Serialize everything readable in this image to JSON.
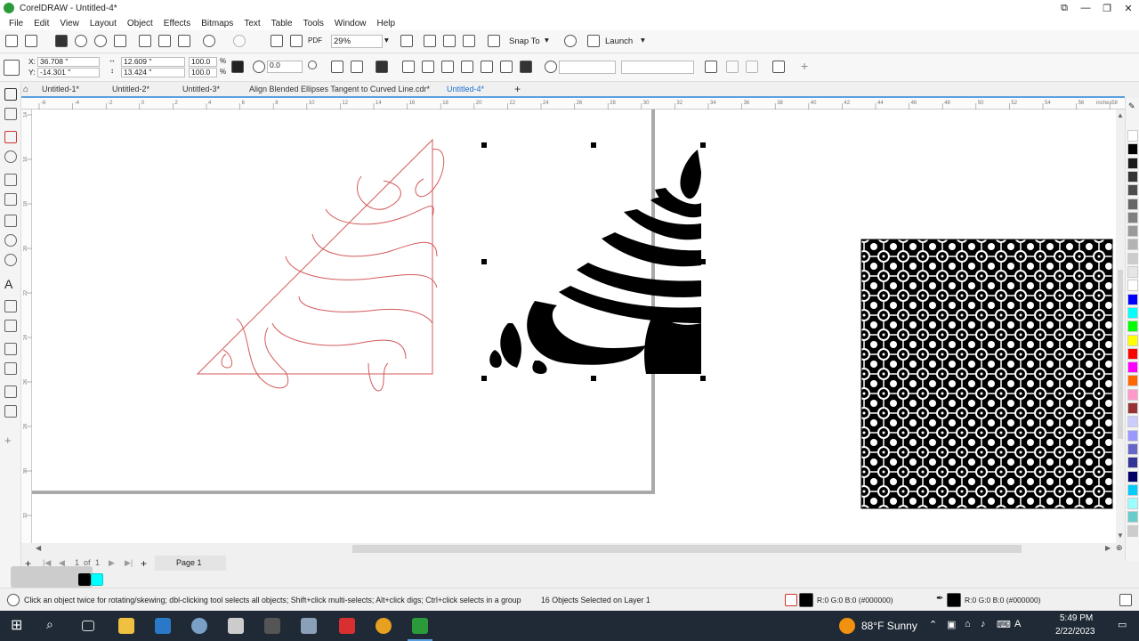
{
  "app": {
    "title": "CorelDRAW - Untitled-4*",
    "window_buttons": [
      "⧉",
      "—",
      "❐",
      "✕"
    ]
  },
  "menu": [
    "File",
    "Edit",
    "View",
    "Layout",
    "Object",
    "Effects",
    "Bitmaps",
    "Text",
    "Table",
    "Tools",
    "Window",
    "Help"
  ],
  "toolbar": {
    "zoom_value": "29%",
    "snap_to_label": "Snap To",
    "launch_label": "Launch",
    "pdf_label": "PDF"
  },
  "property_bar": {
    "x_label": "X:",
    "x_value": "36.708 \"",
    "y_label": "Y:",
    "y_value": "-14.301 \"",
    "width_value": "12.609 \"",
    "height_value": "13.424 \"",
    "scale_w": "100.0",
    "scale_h": "100.0",
    "percent": "%",
    "rotation_value": "0.0"
  },
  "tabs": [
    "Untitled-1*",
    "Untitled-2*",
    "Untitled-3*",
    "Align Blended Ellipses Tangent to Curved Line.cdr*",
    "Untitled-4*"
  ],
  "active_tab": 4,
  "ruler": {
    "h_ticks": [
      "-6",
      "-4",
      "-2",
      "0",
      "2",
      "4",
      "6",
      "8",
      "10",
      "12",
      "14",
      "16",
      "18",
      "20",
      "22",
      "24",
      "26",
      "28",
      "30",
      "32",
      "34",
      "36",
      "38",
      "40",
      "42",
      "44",
      "46",
      "48",
      "50",
      "52",
      "54",
      "56",
      "58",
      "60",
      "62"
    ],
    "h_unit": "inches",
    "v_ticks": [
      "14",
      "16",
      "18",
      "20",
      "22",
      "24",
      "26",
      "28",
      "30",
      "32"
    ]
  },
  "page_nav": {
    "current": "1",
    "of_label": "of",
    "total": "1",
    "page_tab": "Page 1"
  },
  "status": {
    "hint": "Click an object twice for rotating/skewing; dbl-clicking tool selects all objects; Shift+click multi-selects; Alt+click digs; Ctrl+click selects in a group",
    "selection": "16 Objects Selected on Layer 1",
    "fill_info": "R:0 G:0 B:0 (#000000)",
    "outline_info": "R:0 G:0 B:0 (#000000)"
  },
  "palette_colors": [
    "#ffffff",
    "#000000",
    "#1a1a1a",
    "#333333",
    "#4d4d4d",
    "#666666",
    "#808080",
    "#999999",
    "#b3b3b3",
    "#cccccc",
    "#e6e6e6",
    "#ffffff",
    "#0000ff",
    "#00ffff",
    "#00ff00",
    "#ffff00",
    "#ff0000",
    "#ff00ff",
    "#ff6600",
    "#ff99cc",
    "#993333",
    "#ccccff",
    "#9999ff",
    "#6666cc",
    "#333399",
    "#000066",
    "#00ccff",
    "#99ffff",
    "#66cccc",
    "#cccccc"
  ],
  "taskbar": {
    "weather": "88°F  Sunny",
    "time": "5:49 PM",
    "date": "2/22/2023"
  },
  "colors": {
    "outline_red": "#d45a5a",
    "accent_blue": "#5aa0e0",
    "taskbar_bg": "#1f2a36"
  }
}
